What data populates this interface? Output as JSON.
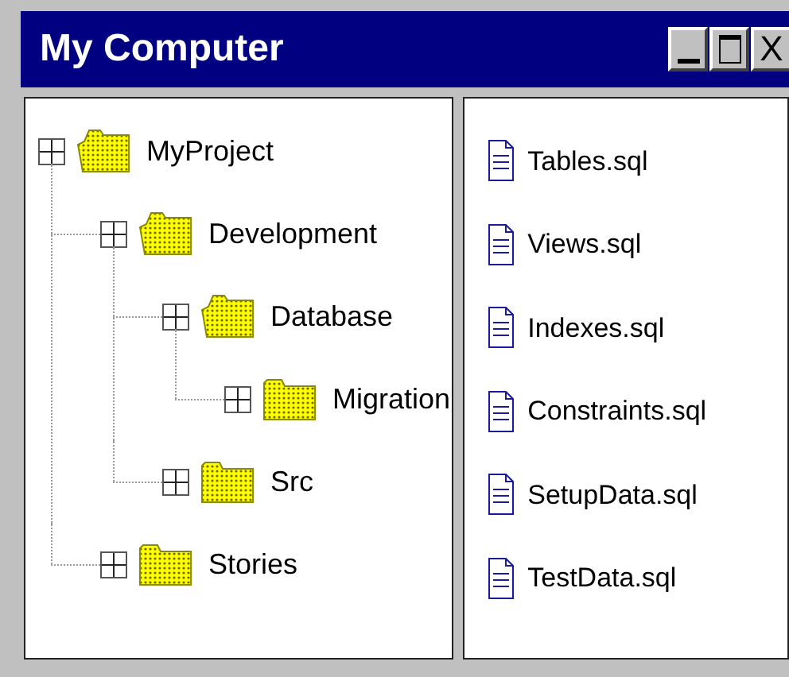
{
  "window": {
    "title": "My Computer",
    "close_label": "X"
  },
  "tree": [
    {
      "label": "MyProject",
      "children": [
        {
          "label": "Development",
          "children": [
            {
              "label": "Database",
              "children": [
                {
                  "label": "Migration"
                }
              ]
            },
            {
              "label": "Src"
            }
          ]
        },
        {
          "label": "Stories"
        }
      ]
    }
  ],
  "files": [
    {
      "name": "Tables.sql"
    },
    {
      "name": "Views.sql"
    },
    {
      "name": "Indexes.sql"
    },
    {
      "name": "Constraints.sql"
    },
    {
      "name": "SetupData.sql"
    },
    {
      "name": "TestData.sql"
    }
  ]
}
